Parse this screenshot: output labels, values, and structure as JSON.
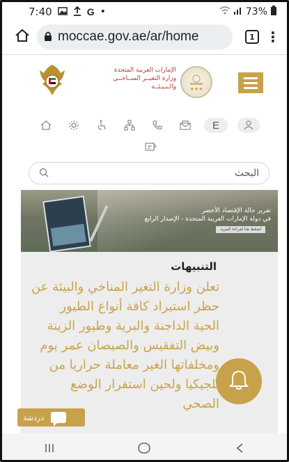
{
  "status_bar": {
    "time": "7:40",
    "battery": "73%",
    "notification_icons": [
      "image-icon",
      "upload-icon",
      "google-icon",
      "dot-icon"
    ]
  },
  "browser": {
    "url": "moccae.gov.ae/ar/home",
    "tab_count": "1"
  },
  "header": {
    "emblem_name": "uae-emblem",
    "ministry_lines": [
      "الإمارات العربية المتحدة",
      "وزارة التغيــر المنــاخــي",
      "والـبـيـئــة"
    ]
  },
  "accessibility_bar": {
    "language_label": "E",
    "icons": [
      "home-icon",
      "settings-icon",
      "accessibility-icon",
      "sitemap-icon",
      "phone-icon",
      "mail-icon",
      "language-icon",
      "user-icon",
      "feedback-icon"
    ]
  },
  "search": {
    "placeholder": "البحث"
  },
  "banner": {
    "title": "تقرير حالة الإقتصاد الأخضر",
    "subtitle": "في دولة الإمارات العربية المتحدة - الإصدار الرابع",
    "button_label": "اضغط هنا لقراءة المزيد"
  },
  "alerts": {
    "title": "التنبيهات",
    "body": "تعلن وزارة التغير المناخي والبيئة عن حظر استيراد كافة أنواع الطيور الحية الداجنة والبرية وطيور الزينة وبيض التفقيس والصيصان عمر يوم ومخلفاتها الغير معاملة حراريا من بلجيكيا ولحين استقرار الوضع الصحي"
  },
  "chat": {
    "label": "دردشة"
  },
  "colors": {
    "gold": "#c7a24b",
    "alert_text": "#c9a44b",
    "ministry_red": "#b3402f"
  }
}
